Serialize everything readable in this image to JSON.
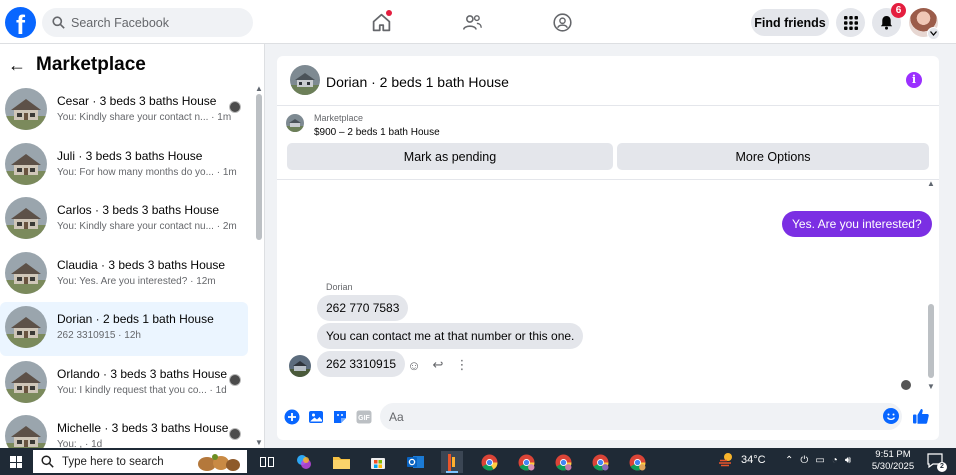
{
  "topbar": {
    "logo": "f",
    "search_placeholder": "Search Facebook",
    "find_friends": "Find friends",
    "notification_count": "6"
  },
  "sidebar": {
    "back_arrow": "←",
    "title": "Marketplace",
    "conversations": [
      {
        "title": "Cesar · 3 beds 3 baths House",
        "preview": "You: Kindly share your contact n...",
        "time": "1m"
      },
      {
        "title": "Juli · 3 beds 3 baths House",
        "preview": "You: For how many months do yo...",
        "time": "1m"
      },
      {
        "title": "Carlos · 3 beds 3 baths House",
        "preview": "You: Kindly share your contact nu...",
        "time": "2m"
      },
      {
        "title": "Claudia · 3 beds 3 baths House",
        "preview": "You: Yes. Are you interested?",
        "time": "12m"
      },
      {
        "title": "Dorian · 2 beds 1 bath House",
        "preview": "262 3310915",
        "time": "12h"
      },
      {
        "title": "Orlando · 3 beds 3 baths House",
        "preview": "You: I kindly request that you co...",
        "time": "1d"
      },
      {
        "title": "Michelle · 3 beds 3 baths House",
        "preview": "You: ,",
        "time": "1d"
      }
    ]
  },
  "chat": {
    "title": "Dorian · 2 beds 1 bath House",
    "info_glyph": "i",
    "marketplace_label": "Marketplace",
    "listing": "$900 – 2 beds 1 bath House",
    "mark_pending": "Mark as pending",
    "more_options": "More Options",
    "outgoing_message": "Yes. Are you interested?",
    "sender_name": "Dorian",
    "incoming": [
      "262 770 7583",
      "You can contact me at that number or this one.",
      "262 3310915"
    ],
    "composer_placeholder": "Aa",
    "gif_label": "GIF"
  },
  "taskbar": {
    "search_placeholder": "Type here to search",
    "temperature": "34°C",
    "time": "9:51 PM",
    "date": "5/30/2025",
    "notification_count": "2"
  },
  "colors": {
    "facebook_blue": "#0866ff",
    "messenger_purple": "#7b2fe3",
    "badge_red": "#e41e3f",
    "taskbar": "#1f2a36"
  }
}
